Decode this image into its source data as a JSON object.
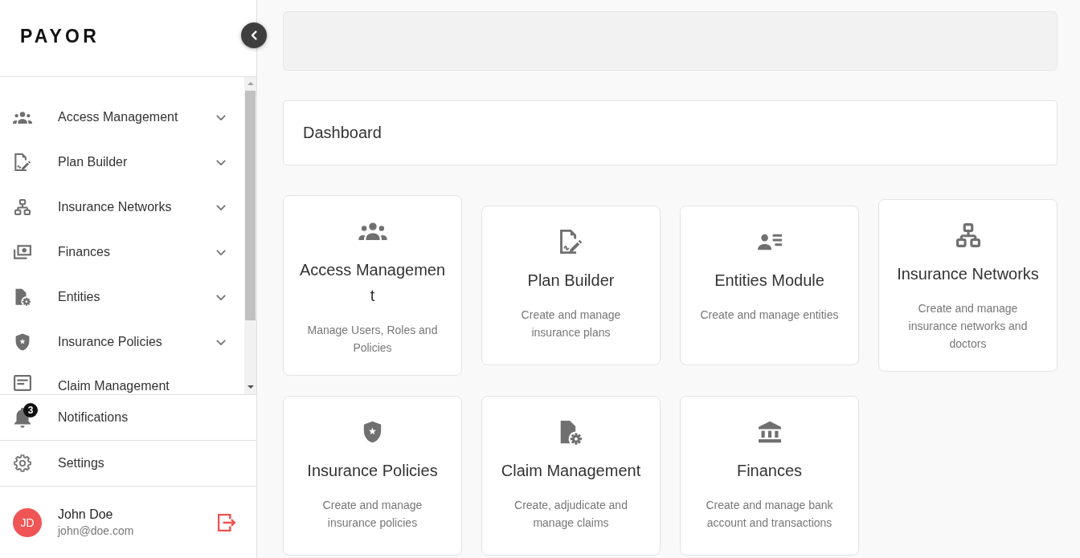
{
  "sidebar": {
    "logo": "PAYOR",
    "nav_items": [
      {
        "label": "Access Management",
        "expandable": true
      },
      {
        "label": "Plan Builder",
        "expandable": true
      },
      {
        "label": "Insurance Networks",
        "expandable": true
      },
      {
        "label": "Finances",
        "expandable": true
      },
      {
        "label": "Entities",
        "expandable": true
      },
      {
        "label": "Insurance Policies",
        "expandable": true
      },
      {
        "label": "Claim Management",
        "expandable": false
      }
    ],
    "notifications": {
      "label": "Notifications",
      "badge": "3"
    },
    "settings": {
      "label": "Settings"
    },
    "user": {
      "initials": "JD",
      "name": "John Doe",
      "email": "john@doe.com"
    }
  },
  "main": {
    "page_title": "Dashboard",
    "modules": [
      {
        "title": "Access Management",
        "description": "Manage Users, Roles and Policies"
      },
      {
        "title": "Plan Builder",
        "description": "Create and manage insurance plans"
      },
      {
        "title": "Entities Module",
        "description": "Create and manage entities"
      },
      {
        "title": "Insurance Networks",
        "description": "Create and manage insurance networks and doctors"
      },
      {
        "title": "Insurance Policies",
        "description": "Create and manage insurance policies"
      },
      {
        "title": "Claim Management",
        "description": "Create, adjudicate and manage claims"
      },
      {
        "title": "Finances",
        "description": "Create and manage bank account and transactions"
      }
    ]
  }
}
